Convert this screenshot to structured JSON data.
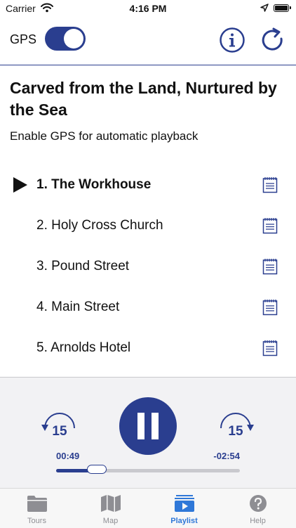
{
  "status_bar": {
    "carrier": "Carrier",
    "time": "4:16 PM"
  },
  "header": {
    "gps_label": "GPS",
    "gps_enabled": true,
    "accent_color": "#2a3e8f"
  },
  "main": {
    "title": "Carved from the Land, Nurtured by the Sea",
    "subtitle": "Enable GPS for automatic playback",
    "tracks": [
      {
        "label": "1. The Workhouse",
        "active": true
      },
      {
        "label": "2. Holy Cross Church",
        "active": false
      },
      {
        "label": "3. Pound Street",
        "active": false
      },
      {
        "label": "4. Main Street",
        "active": false
      },
      {
        "label": "5. Arnolds Hotel",
        "active": false
      }
    ]
  },
  "player": {
    "skip_back_seconds": "15",
    "skip_forward_seconds": "15",
    "elapsed": "00:49",
    "remaining": "-02:54",
    "progress_fraction": 0.22
  },
  "tabbar": {
    "tabs": [
      {
        "label": "Tours",
        "icon": "folder-icon",
        "active": false
      },
      {
        "label": "Map",
        "icon": "map-icon",
        "active": false
      },
      {
        "label": "Playlist",
        "icon": "playlist-icon",
        "active": true
      },
      {
        "label": "Help",
        "icon": "help-icon",
        "active": false
      }
    ],
    "active_color": "#2f78d8",
    "inactive_color": "#8e8e93"
  }
}
